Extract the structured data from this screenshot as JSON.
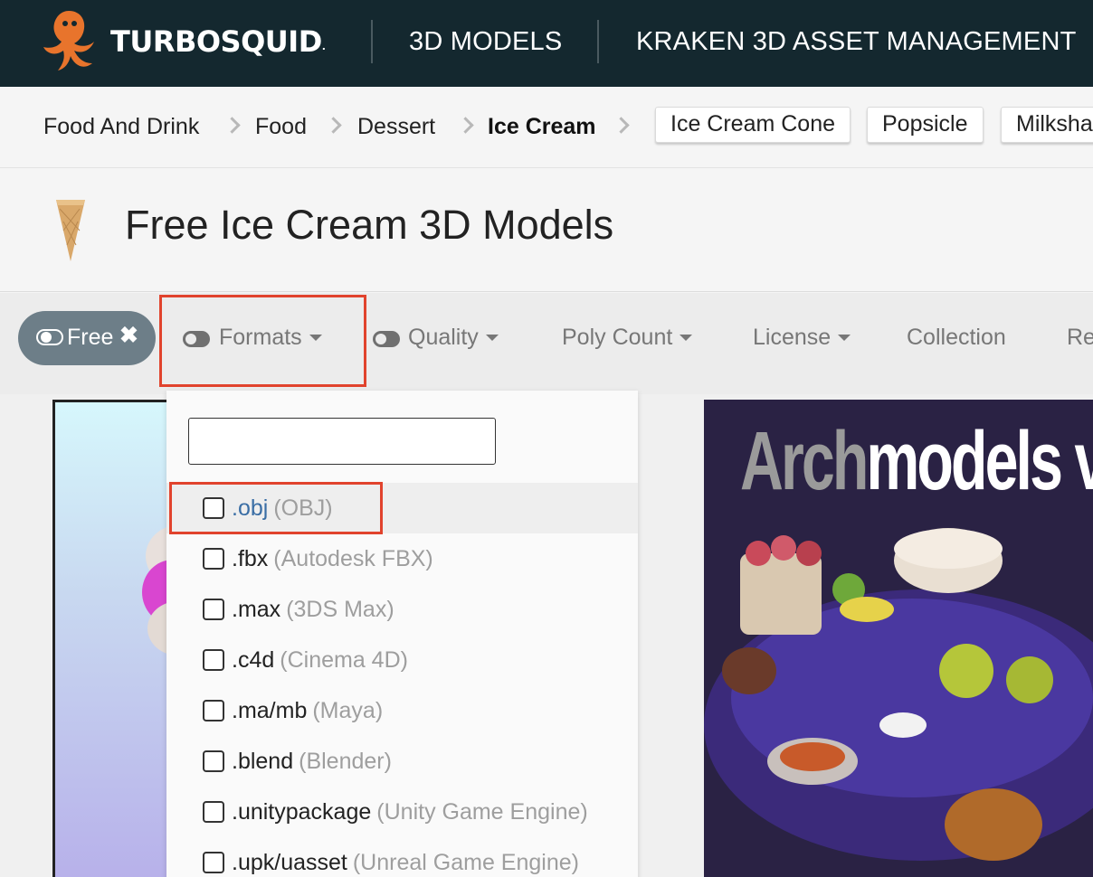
{
  "header": {
    "brand": "TURBOSQUID",
    "brand_mark": ".",
    "nav": [
      "3D MODELS",
      "KRAKEN 3D ASSET MANAGEMENT"
    ]
  },
  "breadcrumb": {
    "items": [
      "Food And Drink",
      "Food",
      "Dessert",
      "Ice Cream"
    ],
    "related_pills": [
      "Ice Cream Cone",
      "Popsicle",
      "Milksha"
    ]
  },
  "page": {
    "title": "Free Ice Cream 3D Models"
  },
  "filters": {
    "free_chip": "Free",
    "free_chip_remove": "✖",
    "items": [
      "Formats",
      "Quality",
      "Poly Count",
      "License",
      "Collection",
      "Re"
    ]
  },
  "formats_dropdown": {
    "search_value": "",
    "options": [
      {
        "ext": ".obj",
        "desc": "(OBJ)",
        "checked": false
      },
      {
        "ext": ".fbx",
        "desc": "(Autodesk FBX)",
        "checked": false
      },
      {
        "ext": ".max",
        "desc": "(3DS Max)",
        "checked": false
      },
      {
        "ext": ".c4d",
        "desc": "(Cinema 4D)",
        "checked": false
      },
      {
        "ext": ".ma/mb",
        "desc": "(Maya)",
        "checked": false
      },
      {
        "ext": ".blend",
        "desc": "(Blender)",
        "checked": false
      },
      {
        "ext": ".unitypackage",
        "desc": "(Unity Game Engine)",
        "checked": false
      },
      {
        "ext": ".upk/uasset",
        "desc": "(Unreal Game Engine)",
        "checked": false
      }
    ]
  },
  "ad": {
    "prefix": "Arch",
    "rest": "models vo"
  },
  "colors": {
    "header_bg": "#14282f",
    "highlight": "#e1432d",
    "link_blue": "#3a6ea5",
    "free_chip": "#6d7e88"
  }
}
